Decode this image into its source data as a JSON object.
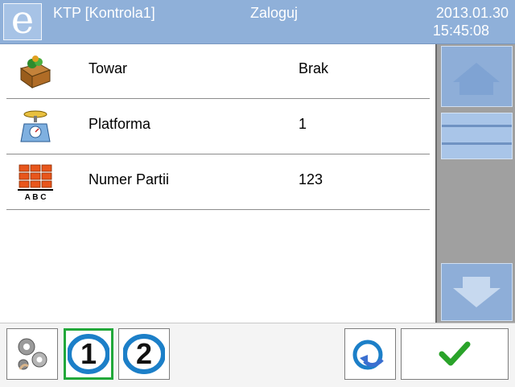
{
  "header": {
    "logo": "e",
    "title": "KTP [Kontrola1]",
    "login": "Zaloguj",
    "date": "2013.01.30",
    "time": "15:45:08"
  },
  "rows": [
    {
      "label": "Towar",
      "value": "Brak",
      "icon": "product-box-icon"
    },
    {
      "label": "Platforma",
      "value": "1",
      "icon": "scale-platform-icon"
    },
    {
      "label": "Numer Partii",
      "value": "123",
      "icon": "batch-number-icon"
    }
  ],
  "footer": {
    "profile1": "1",
    "profile2": "2"
  },
  "colors": {
    "header": "#8fb0d9",
    "scroll_button": "#8eaed8",
    "active_border": "#22a83a",
    "ok_check": "#2aa32a"
  }
}
